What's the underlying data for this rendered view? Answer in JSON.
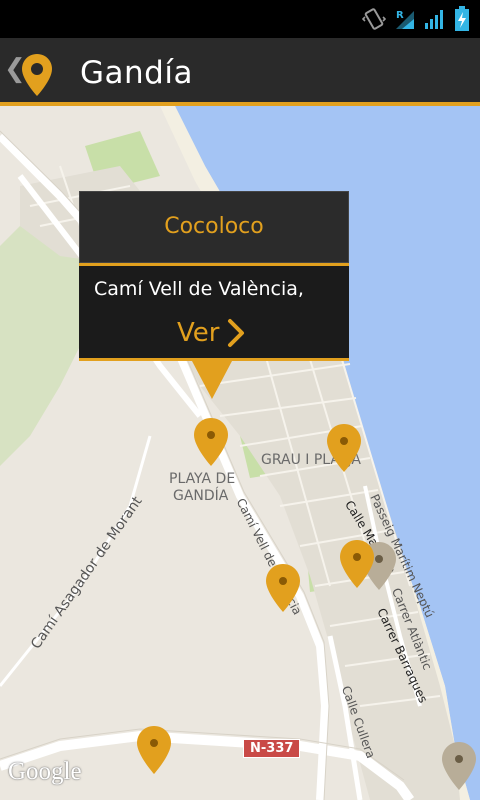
{
  "status_bar": {
    "icons": [
      "vibrate-icon",
      "wifi-icon",
      "signal-icon",
      "battery-icon"
    ],
    "signal_badge": "R"
  },
  "action_bar": {
    "title": "Gandía",
    "back_icon": "chevron-left-icon",
    "app_icon": "map-pin-icon"
  },
  "popup": {
    "name": "Cocoloco",
    "address": "Camí Vell de València,",
    "action_label": "Ver",
    "action_icon": "chevron-right-icon"
  },
  "map_labels": {
    "playa_de_gandia_line1": "PLAYA DE",
    "playa_de_gandia_line2": "GANDÍA",
    "grau_i_platja": "GRAU I PLATJA",
    "cami_asagador": "Camí Asagador de Morant",
    "cami_vell": "Camí Vell de València",
    "calle_mallorca": "Calle Mallorca",
    "passeig": "Passeig Marítim Neptú",
    "carrer_atlantic": "Carrer Atlàntic",
    "carrer_barraques": "Carrer Barraques",
    "calle_cullera": "Calle Cullera",
    "road_badge": "N-337",
    "attribution": "Google"
  },
  "colors": {
    "accent": "#e2a01e",
    "sea": "#a4c4f4",
    "land": "#ebe7df",
    "park": "#c8dfa8",
    "road": "#ffffff"
  }
}
